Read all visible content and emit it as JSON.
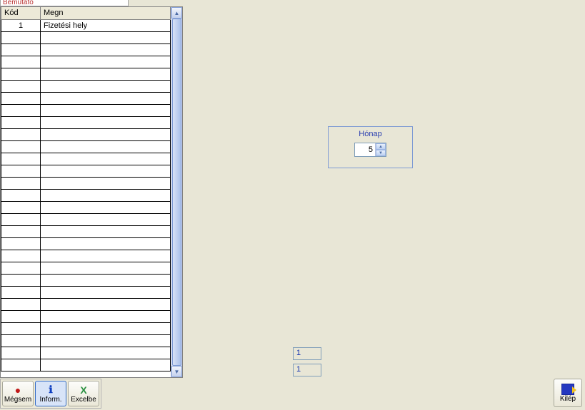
{
  "tab": {
    "label": "Bemutató"
  },
  "table": {
    "headers": {
      "kod": "Kód",
      "megn": "Megn"
    },
    "rows": [
      {
        "kod": "1",
        "megn": "Fizetési hely"
      }
    ],
    "empty_row_count": 28
  },
  "honap": {
    "label": "Hónap",
    "value": "5"
  },
  "readouts": {
    "r1": "1",
    "r2": "1"
  },
  "toolbar": {
    "megsem": "Mégsem",
    "inform": "Inform.",
    "excel": "Excelbe"
  },
  "exit": {
    "label": "Kilép"
  }
}
